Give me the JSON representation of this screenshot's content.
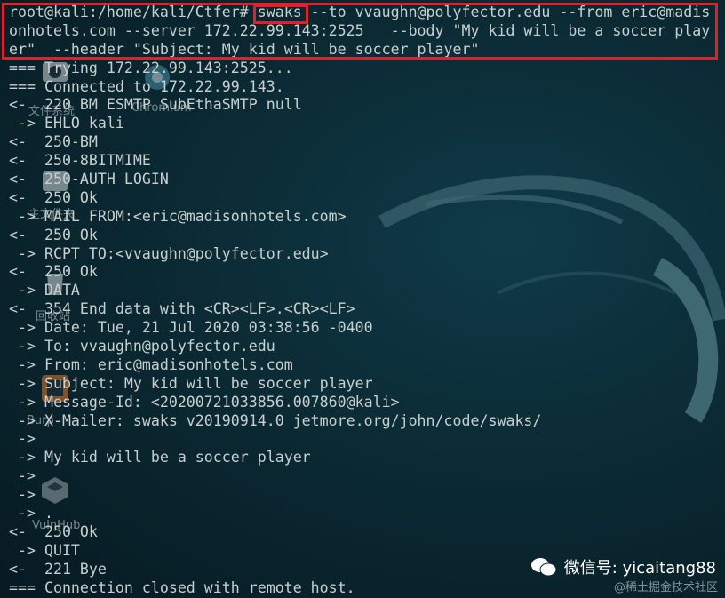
{
  "terminal": {
    "lines": [
      "root@kali:/home/kali/Ctfer# swaks --to vvaughn@polyfector.edu --from eric@madis",
      "onhotels.com --server 172.22.99.143:2525   --body \"My kid will be a soccer play",
      "er\"  --header \"Subject: My kid will be soccer player\"",
      "=== Trying 172.22.99.143:2525...",
      "=== Connected to 172.22.99.143.",
      "<-  220 BM ESMTP SubEthaSMTP null",
      " -> EHLO kali",
      "<-  250-BM",
      "<-  250-8BITMIME",
      "<-  250-AUTH LOGIN",
      "<-  250 Ok",
      " -> MAIL FROM:<eric@madisonhotels.com>",
      "<-  250 Ok",
      " -> RCPT TO:<vvaughn@polyfector.edu>",
      "<-  250 Ok",
      " -> DATA",
      "<-  354 End data with <CR><LF>.<CR><LF>",
      " -> Date: Tue, 21 Jul 2020 03:38:56 -0400",
      " -> To: vvaughn@polyfector.edu",
      " -> From: eric@madisonhotels.com",
      " -> Subject: My kid will be soccer player",
      " -> Message-Id: <20200721033856.007860@kali>",
      " -> X-Mailer: swaks v20190914.0 jetmore.org/john/code/swaks/",
      " ->",
      " -> My kid will be a soccer player",
      " ->",
      " ->",
      " -> .",
      "<-  250 Ok",
      " -> QUIT",
      "<-  221 Bye",
      "=== Connection closed with remote host."
    ]
  },
  "desktop_icons": [
    {
      "name": "文件系统",
      "icon": "folder-icon"
    },
    {
      "name": "Chromium",
      "icon": "chromium-icon"
    },
    {
      "name": "主文件夹",
      "icon": "home-folder-icon"
    },
    {
      "name": "回收站",
      "icon": "trash-icon"
    },
    {
      "name": "Burp",
      "icon": "burp-icon"
    },
    {
      "name": "VulnHub",
      "icon": "vulnhub-icon"
    }
  ],
  "watermark": {
    "wechat": "微信号: yicaitang88",
    "site": "@稀土掘金技术社区"
  },
  "colors": {
    "highlight": "#e0202a",
    "terminal_text": "#c8d0cf",
    "background": "#0b2a34"
  }
}
